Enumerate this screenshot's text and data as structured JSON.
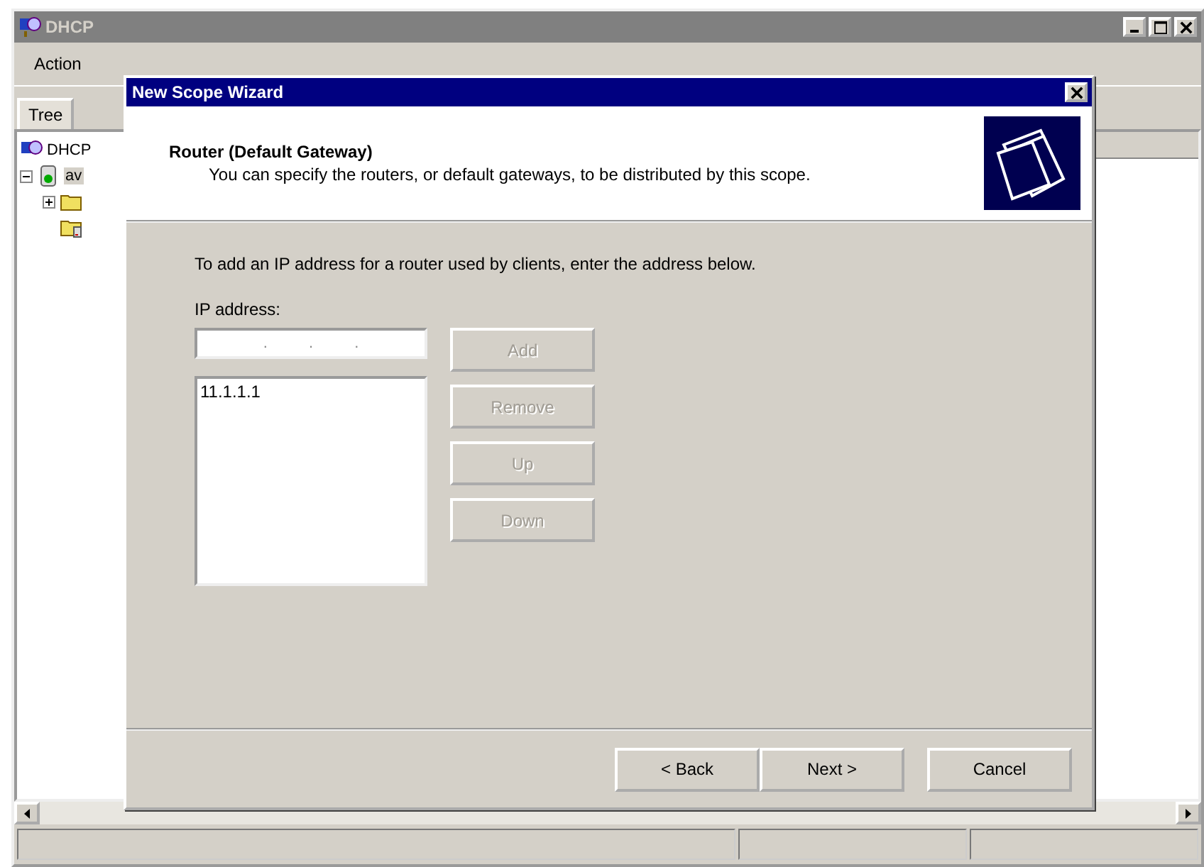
{
  "main_window": {
    "title": "DHCP",
    "menu": [
      "Action"
    ],
    "tabs": [
      {
        "label": "Tree",
        "selected": true
      }
    ],
    "tree": [
      {
        "label": "DHCP",
        "children": [
          {
            "label": "av",
            "expanded": true,
            "children": [
              {
                "kind": "folder",
                "expanded": false
              },
              {
                "kind": "folder_document"
              }
            ]
          }
        ]
      }
    ]
  },
  "dialog": {
    "title": "New Scope Wizard",
    "heading": "Router (Default Gateway)",
    "subheading": "You can specify the routers, or default gateways, to be distributed by this scope.",
    "instruction": "To add an IP address for a router used by clients, enter the address below.",
    "ip_field": {
      "label": "IP address:",
      "value": ". . ."
    },
    "address_list": [
      {
        "label": "11.1.1.1",
        "selected": false
      }
    ],
    "side_buttons": [
      {
        "label": "Add",
        "disabled": true
      },
      {
        "label": "Remove",
        "disabled": true
      },
      {
        "label": "Up",
        "disabled": true
      },
      {
        "label": "Down",
        "disabled": true
      }
    ],
    "footer_buttons": [
      {
        "label": "< Back",
        "disabled": false
      },
      {
        "label": "Next >",
        "disabled": false
      },
      {
        "label": "Cancel",
        "disabled": false
      }
    ]
  }
}
